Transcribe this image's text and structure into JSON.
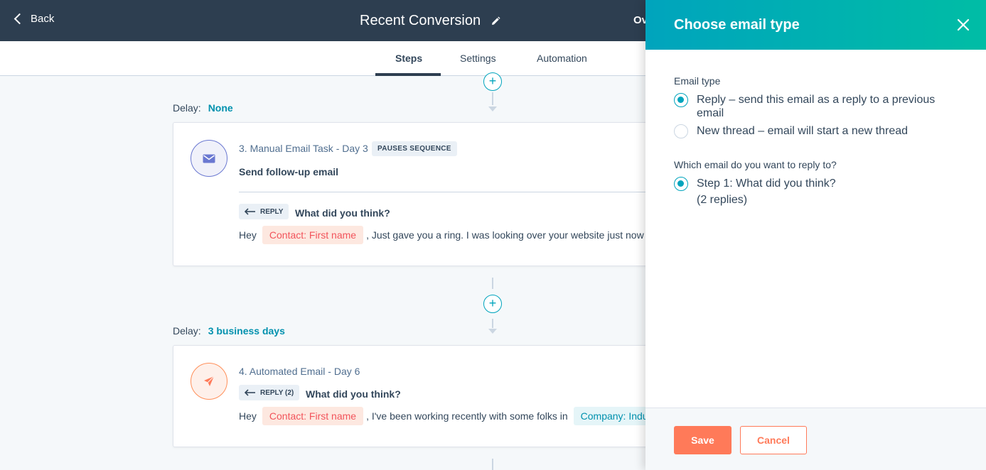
{
  "header": {
    "back_label": "Back",
    "title": "Recent Conversion",
    "right_partial": "Ov"
  },
  "tabs": [
    {
      "label": "Steps",
      "active": true
    },
    {
      "label": "Settings",
      "active": false
    },
    {
      "label": "Automation",
      "active": false
    }
  ],
  "steps": [
    {
      "delay_label": "Delay:",
      "delay_value": "None",
      "title": "3. Manual Email Task - Day 3",
      "badge": "PAUSES SEQUENCE",
      "subtitle": "Send follow-up email",
      "icon": "envelope-icon",
      "reply_tag": "REPLY",
      "reply_subject": "What did you think?",
      "body_prefix": "Hey",
      "contact_token": "Contact: First name",
      "body_suffix": ", Just gave you a ring. I was looking over your website just now a"
    },
    {
      "delay_label": "Delay:",
      "delay_value": "3 business days",
      "title": "4. Automated Email - Day 6",
      "icon": "paper-plane-icon",
      "reply_tag": "REPLY (2)",
      "reply_subject": "What did you think?",
      "body_prefix": "Hey",
      "contact_token": "Contact: First name",
      "body_middle": ", I've been working recently with some folks in",
      "company_token": "Company: Indust"
    }
  ],
  "panel": {
    "title": "Choose email type",
    "email_type_label": "Email type",
    "options": [
      {
        "label": "Reply – send this email as a reply to a previous email",
        "checked": true
      },
      {
        "label": "New thread – email will start a new thread",
        "checked": false
      }
    ],
    "reply_to_label": "Which email do you want to reply to?",
    "reply_options": [
      {
        "label": "Step 1: What did you think?",
        "sub": "(2 replies)",
        "checked": true
      }
    ],
    "save_label": "Save",
    "cancel_label": "Cancel"
  },
  "colors": {
    "header_bg": "#2d3e50",
    "accent_teal": "#00a4bd",
    "accent_orange": "#ff7a59"
  }
}
